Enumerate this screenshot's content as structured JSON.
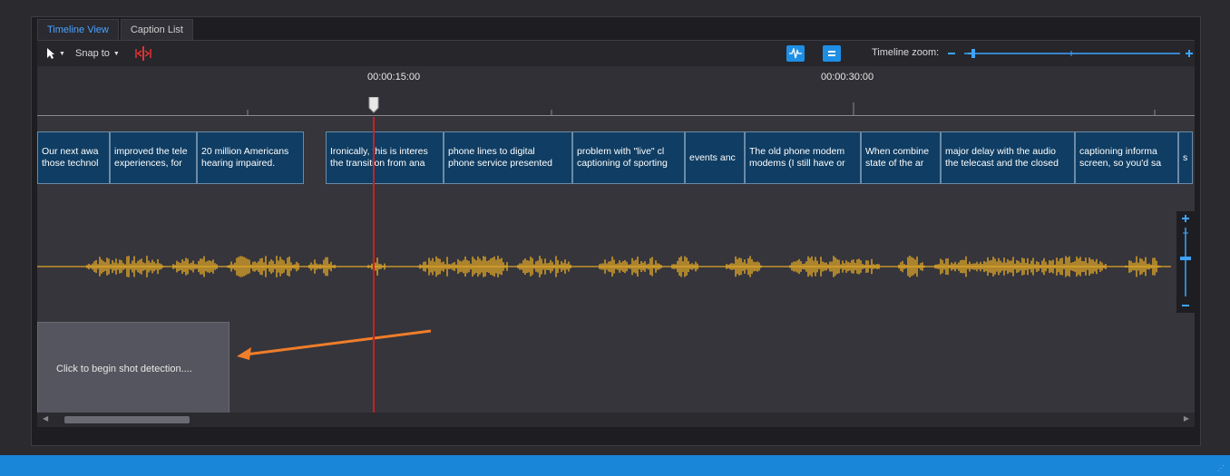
{
  "tabs": [
    {
      "label": "Timeline View"
    },
    {
      "label": "Caption List"
    }
  ],
  "toolbar": {
    "pointer_icon": "cursor-arrow-icon",
    "snap_label": "Snap to",
    "split_icon": "split-clip-icon",
    "waveform_icon": "waveform-icon",
    "captions_icon": "caption-toggle-icon",
    "zoom_label": "Timeline zoom:"
  },
  "ruler": {
    "labels": [
      "00:00:15:00",
      "00:00:30:00"
    ]
  },
  "captions": [
    {
      "text": "Our next awa\nthose technol"
    },
    {
      "text": "improved the tele\nexperiences, for"
    },
    {
      "text": "20 million Americans\nhearing impaired."
    },
    {
      "text": "Ironically, this is interes\nthe transition from ana"
    },
    {
      "text": "phone lines to digital\nphone service presented"
    },
    {
      "text": "problem with \"live\" cl\ncaptioning of sporting"
    },
    {
      "text": "events anc"
    },
    {
      "text": "The old phone modem\nmodems (I still have or"
    },
    {
      "text": "When combine\nstate of the ar"
    },
    {
      "text": "major delay with the audio\nthe telecast and the closed"
    },
    {
      "text": "captioning informa\nscreen, so you'd sa"
    },
    {
      "text": "s"
    }
  ],
  "shot_detection": {
    "label": "Click to begin shot detection...."
  },
  "colors": {
    "accent": "#1f8fe5",
    "caption_bg": "#0f3d63",
    "waveform": "#e0a628",
    "playhead": "#cc1f1f",
    "annotation_arrow": "#ef7d2a",
    "status_bar": "#1a86d8"
  }
}
